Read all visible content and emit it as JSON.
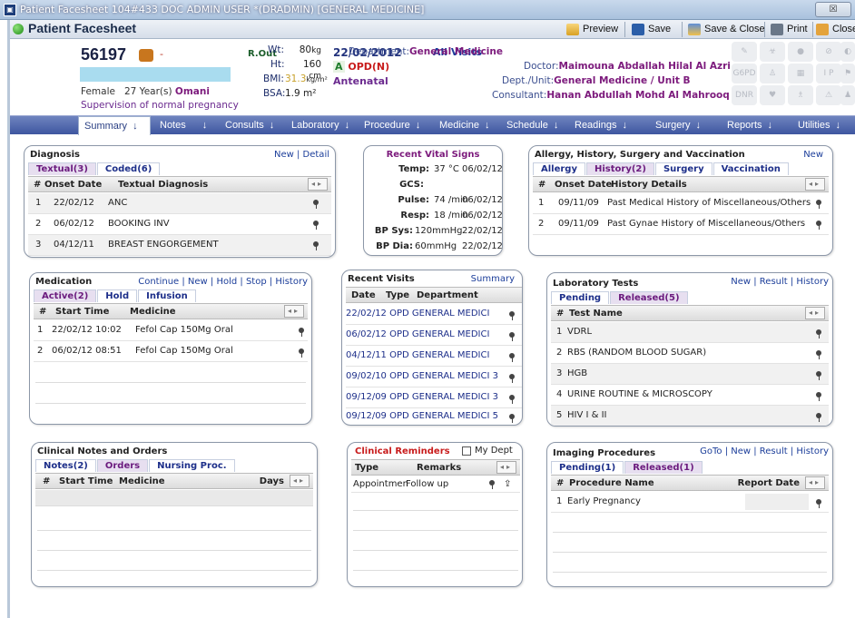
{
  "window": {
    "title": "Patient Facesheet 104#433 DOC ADMIN USER *(DRADMIN) [GENERAL MEDICINE]",
    "close_glyph": "☒"
  },
  "header": {
    "title": "Patient Facesheet",
    "toolbar": {
      "preview": "Preview",
      "save": "Save",
      "save_close": "Save & Close",
      "print": "Print",
      "close": "Close"
    }
  },
  "patient": {
    "id": "56197",
    "dash": "-",
    "status_label": "R.Out",
    "gender": "Female",
    "age": "27 Year(s)",
    "nationality": "Omani",
    "condition": "Supervision of normal pregnancy",
    "vitals": {
      "wt_label": "Wt:",
      "wt_value": "80",
      "wt_unit": "kg",
      "ht_label": "Ht:",
      "ht_value": "160",
      "ht_unit": "cm",
      "bmi_label": "BMI:",
      "bmi_value": "31.3",
      "bmi_unit": "kg/m²",
      "bsa_label": "BSA:",
      "bsa_value": "1.9 m²"
    },
    "visit_date": "22/02/2012",
    "opd_mark": "A",
    "opd": "OPD(N)",
    "visit_type": "Antenatal",
    "all_visits": "All Visits",
    "department_label": "Department:",
    "department": "General Medicine",
    "doctor_label": "Doctor:",
    "doctor": "Maimouna Abdallah Hilal Al Azri",
    "dept_unit_label": "Dept./Unit:",
    "dept_unit": "General Medicine  / Unit B",
    "consultant_label": "Consultant:",
    "consultant": "Hanan Abdullah Mohd Al Mahrooq",
    "alert_icons": {
      "g6pd": "G6PD",
      "dnr": "DNR",
      "ip": "I P"
    }
  },
  "nav": {
    "tabs": [
      "Summary",
      "Notes",
      "Consults",
      "Laboratory",
      "Procedure",
      "Medicine",
      "Schedule",
      "Readings",
      "Surgery",
      "Reports",
      "Utilities"
    ],
    "arrow": "↓"
  },
  "diagnosis": {
    "title": "Diagnosis",
    "links": "New | Detail",
    "tabs": [
      "Textual(3)",
      "Coded(6)"
    ],
    "headers": [
      "#",
      "Onset Date",
      "Textual Diagnosis"
    ],
    "rows": [
      {
        "n": "1",
        "date": "22/02/12",
        "text": "ANC"
      },
      {
        "n": "2",
        "date": "06/02/12",
        "text": "BOOKING INV"
      },
      {
        "n": "3",
        "date": "04/12/11",
        "text": "BREAST ENGORGEMENT"
      }
    ]
  },
  "vitals_panel": {
    "title": "Recent Vital Signs",
    "rows": [
      {
        "label": "Temp:",
        "value": "37 °C",
        "date": "06/02/12"
      },
      {
        "label": "GCS:",
        "value": "",
        "date": ""
      },
      {
        "label": "Pulse:",
        "value": "74 /min",
        "date": "06/02/12"
      },
      {
        "label": "Resp:",
        "value": "18 /min",
        "date": "06/02/12"
      },
      {
        "label": "BP Sys:",
        "value": "120mmHg",
        "date": "22/02/12"
      },
      {
        "label": "BP Dia:",
        "value": "60mmHg",
        "date": "22/02/12"
      }
    ]
  },
  "allergy": {
    "title": "Allergy, History, Surgery and Vaccination",
    "links": "New",
    "tabs": [
      "Allergy",
      "History(2)",
      "Surgery",
      "Vaccination"
    ],
    "headers": [
      "#",
      "Onset Date",
      "History Details"
    ],
    "rows": [
      {
        "n": "1",
        "date": "09/11/09",
        "text": "Past  Medical History of  Miscellaneous/Others"
      },
      {
        "n": "2",
        "date": "09/11/09",
        "text": "Past  Gynae History of  Miscellaneous/Others"
      }
    ]
  },
  "medication": {
    "title": "Medication",
    "links": "Continue | New | Hold | Stop | History",
    "tabs": [
      "Active(2)",
      "Hold",
      "Infusion"
    ],
    "headers": [
      "#",
      "Start Time",
      "Medicine"
    ],
    "rows": [
      {
        "n": "1",
        "time": "22/02/12 10:02",
        "text": "Fefol Cap 150Mg Oral"
      },
      {
        "n": "2",
        "time": "06/02/12 08:51",
        "text": "Fefol Cap 150Mg Oral"
      }
    ]
  },
  "visits": {
    "title": "Recent Visits",
    "links": "Summary",
    "headers": [
      "Date",
      "Type",
      "Department"
    ],
    "rows": [
      {
        "date": "22/02/12",
        "type": "OPD",
        "dept": "GENERAL MEDICI",
        "n": ""
      },
      {
        "date": "06/02/12",
        "type": "OPD",
        "dept": "GENERAL MEDICI",
        "n": ""
      },
      {
        "date": "04/12/11",
        "type": "OPD",
        "dept": "GENERAL MEDICI",
        "n": ""
      },
      {
        "date": "09/02/10",
        "type": "OPD",
        "dept": "GENERAL MEDICI",
        "n": "3"
      },
      {
        "date": "09/12/09",
        "type": "OPD",
        "dept": "GENERAL MEDICI",
        "n": "3"
      },
      {
        "date": "09/12/09",
        "type": "OPD",
        "dept": "GENERAL MEDICI",
        "n": "5"
      }
    ]
  },
  "lab": {
    "title": "Laboratory Tests",
    "links": "New | Result | History",
    "tabs": [
      "Pending",
      "Released(5)"
    ],
    "headers": [
      "#",
      "Test Name"
    ],
    "rows": [
      {
        "n": "1",
        "text": "VDRL"
      },
      {
        "n": "2",
        "text": "RBS (RANDOM BLOOD SUGAR)"
      },
      {
        "n": "3",
        "text": "HGB"
      },
      {
        "n": "4",
        "text": "URINE ROUTINE & MICROSCOPY"
      },
      {
        "n": "5",
        "text": "HIV I & II"
      }
    ]
  },
  "notes": {
    "title": "Clinical Notes and Orders",
    "tabs": [
      "Notes(2)",
      "Orders",
      "Nursing Proc."
    ],
    "headers": [
      "#",
      "Start Time",
      "Medicine",
      "Days"
    ]
  },
  "reminders": {
    "title": "Clinical Reminders",
    "checkbox_label": "My Dept",
    "headers": [
      "Type",
      "Remarks"
    ],
    "rows": [
      {
        "type": "Appointmen",
        "remarks": "Follow up"
      }
    ]
  },
  "imaging": {
    "title": "Imaging Procedures",
    "links": "GoTo | New | Result | History",
    "tabs": [
      "Pending(1)",
      "Released(1)"
    ],
    "headers": [
      "#",
      "Procedure Name",
      "Report Date"
    ],
    "rows": [
      {
        "n": "1",
        "text": "Early Pregnancy"
      }
    ]
  },
  "colors": {
    "nav_bg": "#4a62aa",
    "accent_purple": "#7c1a7c",
    "link_blue": "#1c3e9a",
    "alert_red": "#c81b1b"
  }
}
